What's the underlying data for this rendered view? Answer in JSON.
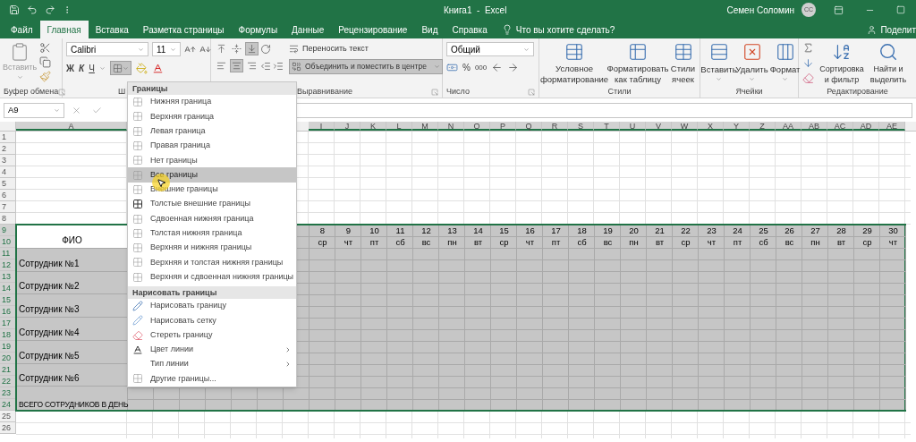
{
  "title_bar": {
    "title": "Книга1  -  Excel",
    "user": "Семен Соломин",
    "avatar": "СС"
  },
  "tabs": [
    {
      "label": "Файл",
      "selected": false
    },
    {
      "label": "Главная",
      "selected": true
    },
    {
      "label": "Вставка",
      "selected": false
    },
    {
      "label": "Разметка страницы",
      "selected": false
    },
    {
      "label": "Формулы",
      "selected": false
    },
    {
      "label": "Данные",
      "selected": false
    },
    {
      "label": "Рецензирование",
      "selected": false
    },
    {
      "label": "Вид",
      "selected": false
    },
    {
      "label": "Справка",
      "selected": false
    }
  ],
  "tell_me": "Что вы хотите сделать?",
  "share": "Поделит",
  "ribbon": {
    "clipboard": {
      "paste": "Вставить",
      "label": "Буфер обмена"
    },
    "font": {
      "font_name": "Calibri",
      "font_size": "11",
      "bold": "Ж",
      "italic": "К",
      "underline": "Ч",
      "borders_pressed": true,
      "label": "Ш"
    },
    "alignment": {
      "vertical": [
        {
          "pressed": false
        },
        {
          "pressed": false
        },
        {
          "pressed": true
        }
      ],
      "horizontal": [
        {
          "pressed": false
        },
        {
          "pressed": true
        },
        {
          "pressed": false
        }
      ],
      "wrap_text": "Переносить текст",
      "merge": "Объединить и поместить в центре",
      "merge_pressed": true,
      "label": "Выравнивание"
    },
    "number": {
      "format": "Общий",
      "percent": "%",
      "thousands": "000",
      "label": "Число"
    },
    "styles": {
      "buttons": [
        {
          "kind": "conditional",
          "label": "Условное форматирование"
        },
        {
          "kind": "table",
          "label": "Форматировать как таблицу"
        },
        {
          "kind": "cell",
          "label": "Стили ячеек"
        }
      ],
      "label": "Стили"
    },
    "cells": {
      "buttons": [
        {
          "kind": "insert",
          "label": "Вставить"
        },
        {
          "kind": "delete",
          "label": "Удалить"
        },
        {
          "kind": "format",
          "label": "Формат"
        }
      ],
      "label": "Ячейки"
    },
    "editing": {
      "sort": "Сортировка и фильтр",
      "find": "Найти и выделить",
      "label": "Редактирование"
    }
  },
  "formula_bar": {
    "name_box": "A9"
  },
  "sheet": {
    "column_headers": [
      "A",
      "I",
      "J",
      "K",
      "L",
      "M",
      "N",
      "O",
      "P",
      "Q",
      "R",
      "S",
      "T",
      "U",
      "V",
      "W",
      "X",
      "Y",
      "Z",
      "AA",
      "AB",
      "AC",
      "AD",
      "AE"
    ],
    "row_numbers": [
      "1",
      "2",
      "3",
      "4",
      "5",
      "6",
      "7",
      "8",
      "9",
      "10",
      "11",
      "12",
      "13",
      "14",
      "15",
      "16",
      "17",
      "18",
      "19",
      "20",
      "21",
      "22",
      "23",
      "24",
      "25",
      "26"
    ],
    "column_a": [
      {
        "kind": "header",
        "text": "ФИО"
      },
      {
        "kind": "employee",
        "text": "Сотрудник №1"
      },
      {
        "kind": "employee",
        "text": "Сотрудник №2"
      },
      {
        "kind": "employee",
        "text": "Сотрудник №3"
      },
      {
        "kind": "employee",
        "text": "Сотрудник №4"
      },
      {
        "kind": "employee",
        "text": "Сотрудник №5"
      },
      {
        "kind": "employee",
        "text": "Сотрудник №6"
      },
      {
        "kind": "total",
        "text": "ВСЕГО СОТРУДНИКОВ В ДЕНЬ"
      }
    ],
    "days": [
      {
        "number": "8",
        "weekday": "ср"
      },
      {
        "number": "9",
        "weekday": "чт"
      },
      {
        "number": "10",
        "weekday": "пт"
      },
      {
        "number": "11",
        "weekday": "сб"
      },
      {
        "number": "12",
        "weekday": "вс"
      },
      {
        "number": "13",
        "weekday": "пн"
      },
      {
        "number": "14",
        "weekday": "вт"
      },
      {
        "number": "15",
        "weekday": "ср"
      },
      {
        "number": "16",
        "weekday": "чт"
      },
      {
        "number": "17",
        "weekday": "пт"
      },
      {
        "number": "18",
        "weekday": "сб"
      },
      {
        "number": "19",
        "weekday": "вс"
      },
      {
        "number": "20",
        "weekday": "пн"
      },
      {
        "number": "21",
        "weekday": "вт"
      },
      {
        "number": "22",
        "weekday": "ср"
      },
      {
        "number": "23",
        "weekday": "чт"
      },
      {
        "number": "24",
        "weekday": "пт"
      },
      {
        "number": "25",
        "weekday": "сб"
      },
      {
        "number": "26",
        "weekday": "вс"
      },
      {
        "number": "27",
        "weekday": "пн"
      },
      {
        "number": "28",
        "weekday": "вт"
      },
      {
        "number": "29",
        "weekday": "ср"
      },
      {
        "number": "30",
        "weekday": "чт"
      }
    ]
  },
  "borders_menu": {
    "title": "Границы",
    "items": [
      {
        "kind": "border",
        "label": "Нижняя граница",
        "selected": false
      },
      {
        "kind": "border",
        "label": "Верхняя граница",
        "selected": false
      },
      {
        "kind": "border",
        "label": "Левая граница",
        "selected": false
      },
      {
        "kind": "border",
        "label": "Правая граница",
        "selected": false
      },
      {
        "kind": "border",
        "label": "Нет границы",
        "selected": false
      },
      {
        "kind": "border",
        "label": "Все границы",
        "selected": true
      },
      {
        "kind": "border",
        "label": "Внешние границы",
        "selected": false
      },
      {
        "kind": "thick-border",
        "label": "Толстые внешние границы",
        "selected": false
      },
      {
        "kind": "border",
        "label": "Сдвоенная нижняя граница",
        "selected": false
      },
      {
        "kind": "border",
        "label": "Толстая нижняя граница",
        "selected": false
      },
      {
        "kind": "border",
        "label": "Верхняя и нижняя границы",
        "selected": false
      },
      {
        "kind": "border",
        "label": "Верхняя и толстая нижняя границы",
        "selected": false
      },
      {
        "kind": "border",
        "label": "Верхняя и сдвоенная нижняя границы",
        "selected": false
      },
      {
        "kind": "section",
        "label": "Нарисовать границы"
      },
      {
        "kind": "pen",
        "label": "Нарисовать границу",
        "selected": false
      },
      {
        "kind": "grid-pen",
        "label": "Нарисовать сетку",
        "selected": false
      },
      {
        "kind": "eraser",
        "label": "Стереть границу",
        "selected": false
      },
      {
        "kind": "line-color",
        "label": "Цвет линии",
        "selected": false,
        "has_submenu": true
      },
      {
        "kind": "line-style",
        "label": "Тип линии",
        "selected": false,
        "has_submenu": true
      },
      {
        "kind": "border",
        "label": "Другие границы...",
        "selected": false
      }
    ]
  }
}
